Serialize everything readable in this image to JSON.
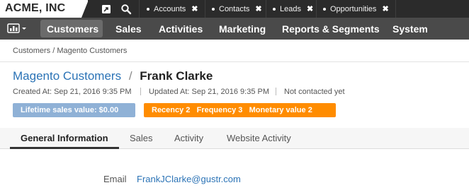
{
  "topbar": {
    "brand": "ACME, INC",
    "icons": [
      "pin-icon",
      "search-icon"
    ],
    "tabs": [
      {
        "label": "Accounts"
      },
      {
        "label": "Contacts"
      },
      {
        "label": "Leads"
      },
      {
        "label": "Opportunities"
      }
    ],
    "close_glyph": "✖"
  },
  "mainnav": {
    "items": [
      {
        "label": "Customers",
        "active": true
      },
      {
        "label": "Sales"
      },
      {
        "label": "Activities"
      },
      {
        "label": "Marketing"
      },
      {
        "label": "Reports & Segments"
      },
      {
        "label": "System"
      }
    ]
  },
  "breadcrumb": "Customers / Magento Customers",
  "header": {
    "parent": "Magento Customers",
    "separator": "/",
    "name": "Frank Clarke",
    "created": "Created At: Sep 21, 2016 9:35 PM",
    "updated": "Updated At: Sep 21, 2016 9:35 PM",
    "contacted": "Not contacted yet"
  },
  "badges": {
    "lifetime": "Lifetime sales value: $0.00",
    "rfm": "Recency 2   Frequency 3   Monetary value 2"
  },
  "tabs": [
    {
      "label": "General Information",
      "active": true
    },
    {
      "label": "Sales"
    },
    {
      "label": "Activity"
    },
    {
      "label": "Website Activity"
    }
  ],
  "fields": {
    "email_label": "Email",
    "email_value": "FrankJClarke@gustr.com"
  },
  "colors": {
    "accent_link": "#2b73b6",
    "badge_blue": "#8fb1d6",
    "badge_orange": "#ff8c00",
    "nav_bg": "#4a4a4a",
    "topbar_bg": "#2b2b2b"
  }
}
